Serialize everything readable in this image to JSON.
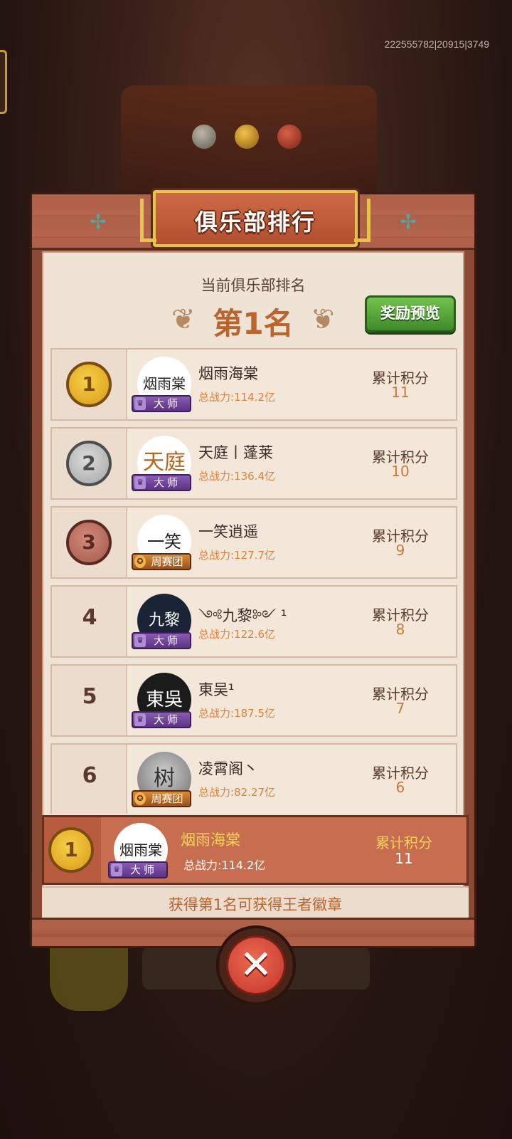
{
  "header": {
    "uid_text": "222555782|20915|3749"
  },
  "dialog": {
    "title": "俱乐部排行",
    "current_rank_label": "当前俱乐部排名",
    "current_rank_value": "第1名",
    "reward_button": "奖励预览",
    "score_label": "累计积分",
    "clubs": [
      {
        "rank": "1",
        "name": "烟雨海棠",
        "power": "总战力:114.2亿",
        "badge": "大师",
        "score": "11",
        "avatar_text": "烟雨棠"
      },
      {
        "rank": "2",
        "name": "天庭丨蓬莱",
        "power": "总战力:136.4亿",
        "badge": "大师",
        "score": "10",
        "avatar_text": "天庭"
      },
      {
        "rank": "3",
        "name": "一笑逍遥",
        "power": "总战力:127.7亿",
        "badge": "周赛团",
        "score": "9",
        "avatar_text": "一笑"
      },
      {
        "rank": "4",
        "name": "༺九黎༻ ¹",
        "power": "总战力:122.6亿",
        "badge": "大师",
        "score": "8",
        "avatar_text": "九黎"
      },
      {
        "rank": "5",
        "name": "東吴¹",
        "power": "总战力:187.5亿",
        "badge": "大师",
        "score": "7",
        "avatar_text": "東吳"
      },
      {
        "rank": "6",
        "name": "凌霄阁丶",
        "power": "总战力:82.27亿",
        "badge": "周赛团",
        "score": "6",
        "avatar_text": "树"
      }
    ],
    "my_club": {
      "rank": "1",
      "name": "烟雨海棠",
      "power": "总战力:114.2亿",
      "badge": "大师",
      "score_label": "累计积分",
      "score": "11",
      "avatar_text": "烟雨棠"
    },
    "hint": "获得第1名可获得王者徽章",
    "close_icon": "✕"
  },
  "colors": {
    "accent": "#b9652e",
    "reward_green": "#4e9d34",
    "close_red": "#d94a3a"
  }
}
